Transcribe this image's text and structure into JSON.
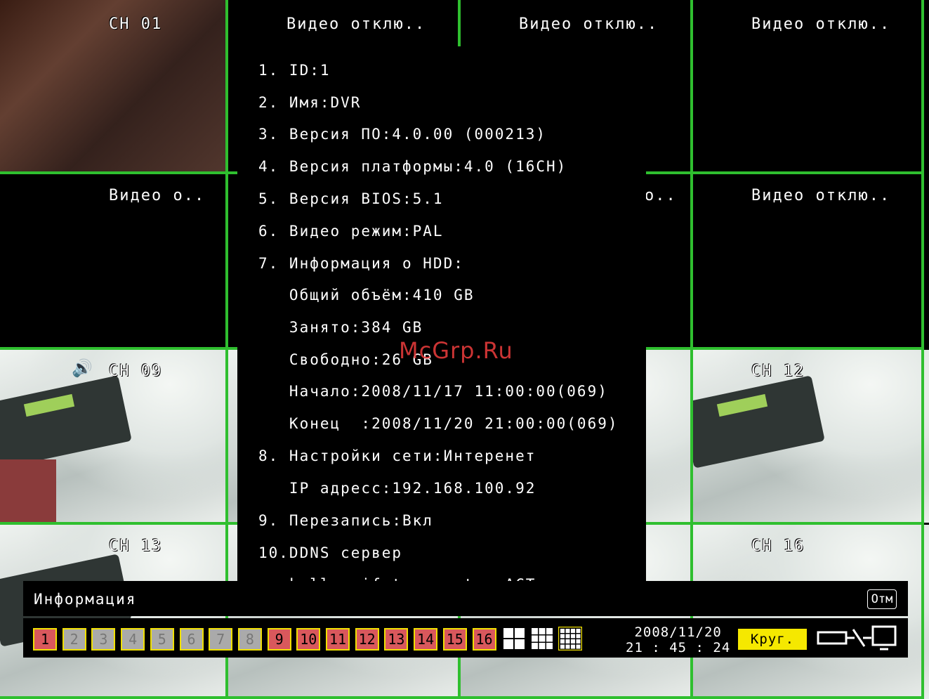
{
  "channels": {
    "ch01": "CH 01",
    "ch09": "CH 09",
    "ch12": "CH 12",
    "ch13": "CH 13",
    "ch16": "CH 16"
  },
  "video_off": {
    "full": "Видео отклю..",
    "short": "Видео о..",
    "partial": "о.."
  },
  "info": {
    "lines": [
      "1. ID:1",
      "2. Имя:DVR",
      "3. Версия ПО:4.0.00 (000213)",
      "4. Версия платформы:4.0 (16CH)",
      "5. Версия BIOS:5.1",
      "6. Видео режим:PAL",
      "7. Информация о HDD:",
      "   Общий объём:410 GB",
      "   Занято:384 GB",
      "   Свободно:26 GB",
      "   Начало:2008/11/17 11:00:00(069)",
      "   Конец  :2008/11/20 21:00:00(069)",
      "8. Настройки сети:Интеренет",
      "   IP адресс:192.168.100.92",
      "9. Перезапись:Вкл",
      "10.DDNS сервер",
      "   kelly.rifatron.net : ACT"
    ]
  },
  "watermark": "McGrp.Ru",
  "window": {
    "title": "Информация",
    "close_label": "Отм"
  },
  "toolbar": {
    "channels": [
      {
        "label": "1",
        "state": "on"
      },
      {
        "label": "2",
        "state": "off"
      },
      {
        "label": "3",
        "state": "off"
      },
      {
        "label": "4",
        "state": "off"
      },
      {
        "label": "5",
        "state": "off"
      },
      {
        "label": "6",
        "state": "off"
      },
      {
        "label": "7",
        "state": "off"
      },
      {
        "label": "8",
        "state": "off"
      },
      {
        "label": "9",
        "state": "on"
      },
      {
        "label": "10",
        "state": "on"
      },
      {
        "label": "11",
        "state": "on"
      },
      {
        "label": "12",
        "state": "on"
      },
      {
        "label": "13",
        "state": "on"
      },
      {
        "label": "14",
        "state": "on"
      },
      {
        "label": "15",
        "state": "on"
      },
      {
        "label": "16",
        "state": "on"
      }
    ],
    "layouts": [
      "layout-4-icon",
      "layout-9-icon",
      "layout-16-icon"
    ],
    "date": "2008/11/20",
    "time": "21 : 45 : 24",
    "cycle_label": "Круг.",
    "display_icon": "display-switch-icon"
  },
  "colors": {
    "grid": "#2fbf2f",
    "channel_on": "#d9585c",
    "channel_border": "#f0e000",
    "cycle_button": "#f5e800",
    "watermark": "#e23a3a"
  }
}
